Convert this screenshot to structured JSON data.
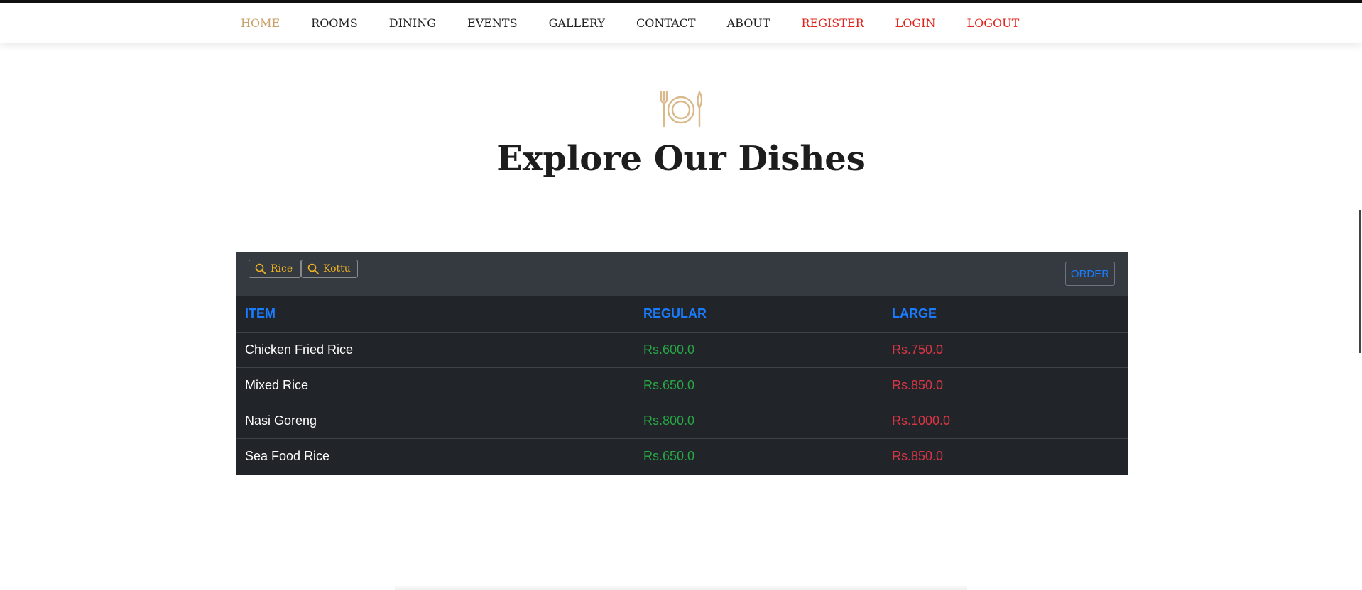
{
  "nav": {
    "items": [
      {
        "label": "HOME",
        "state": "active"
      },
      {
        "label": "ROOMS",
        "state": "normal"
      },
      {
        "label": "DINING",
        "state": "normal"
      },
      {
        "label": "EVENTS",
        "state": "normal"
      },
      {
        "label": "GALLERY",
        "state": "normal"
      },
      {
        "label": "CONTACT",
        "state": "normal"
      },
      {
        "label": "ABOUT",
        "state": "normal"
      },
      {
        "label": "REGISTER",
        "state": "auth"
      },
      {
        "label": "LOGIN",
        "state": "auth"
      },
      {
        "label": "LOGOUT",
        "state": "auth"
      }
    ],
    "colors": {
      "active": "#c9a26b",
      "normal": "#222222",
      "auth": "#e0241c"
    }
  },
  "hero": {
    "icon": "plate-fork-knife-icon",
    "title": "Explore Our Dishes"
  },
  "menu": {
    "filters": [
      {
        "label": "Rice",
        "icon": "search-icon"
      },
      {
        "label": "Kottu",
        "icon": "search-icon"
      }
    ],
    "order_label": "ORDER",
    "columns": [
      "ITEM",
      "REGULAR",
      "LARGE"
    ],
    "rows": [
      {
        "item": "Chicken Fried Rice",
        "regular": "Rs.600.0",
        "large": "Rs.750.0"
      },
      {
        "item": "Mixed Rice",
        "regular": "Rs.650.0",
        "large": "Rs.850.0"
      },
      {
        "item": "Nasi Goreng",
        "regular": "Rs.800.0",
        "large": "Rs.1000.0"
      },
      {
        "item": "Sea Food Rice",
        "regular": "Rs.650.0",
        "large": "Rs.850.0"
      }
    ],
    "colors": {
      "header": "#1a7cff",
      "regular": "#28a745",
      "large": "#dc3545",
      "filter_text": "#f0b323"
    }
  }
}
